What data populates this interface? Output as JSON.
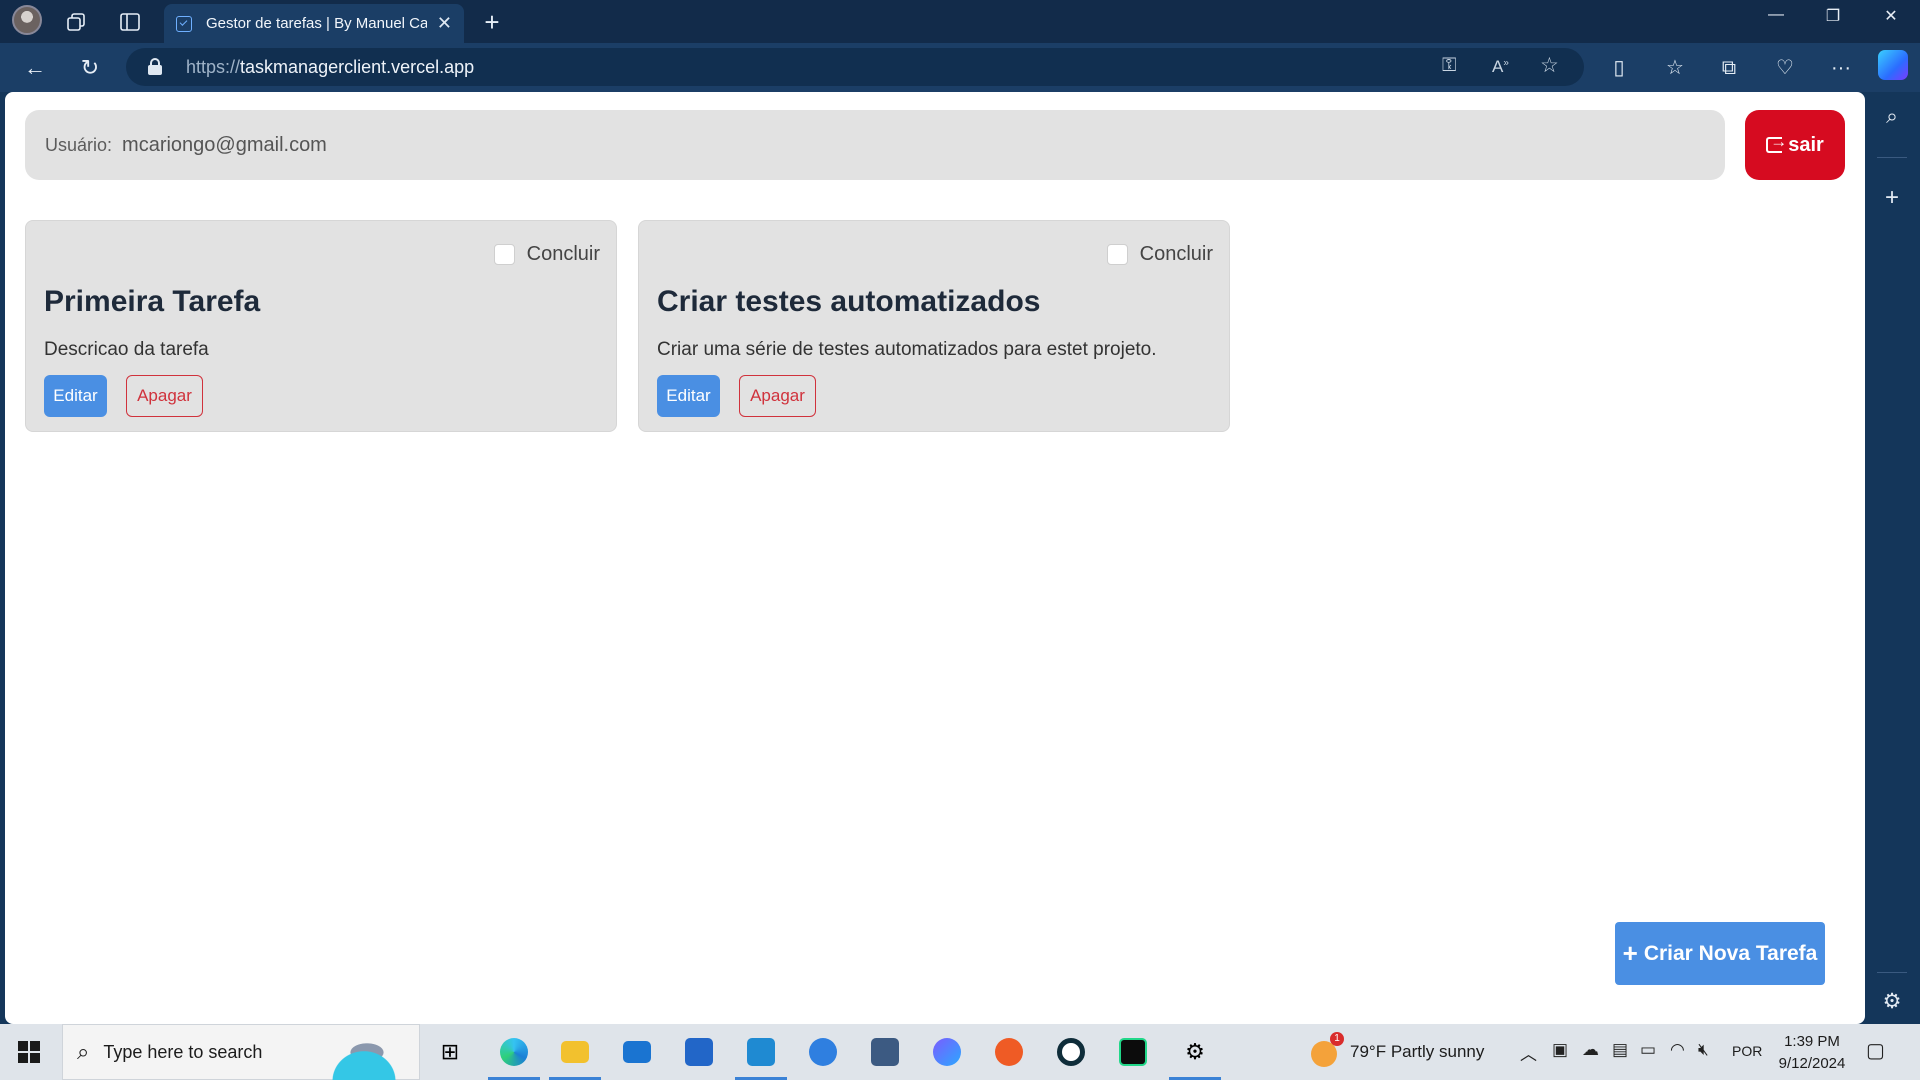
{
  "browser": {
    "tab_title": "Gestor de tarefas | By Manuel Car",
    "tab_close": "✕",
    "new_tab": "+",
    "url_scheme": "https://",
    "url_host": "taskmanagerclient.vercel.app",
    "window_controls": {
      "minimize": "—",
      "restore": "❐",
      "close": "✕"
    }
  },
  "app": {
    "user_label": "Usuário:",
    "user_email": "mcariongo@gmail.com",
    "logout_label": "sair",
    "complete_label": "Concluir",
    "edit_label": "Editar",
    "delete_label": "Apagar",
    "tasks": [
      {
        "title": "Primeira Tarefa",
        "description": "Descricao da tarefa"
      },
      {
        "title": "Criar testes automatizados",
        "description": "Criar uma série de testes automatizados para estet projeto."
      }
    ],
    "create_button": {
      "plus": "+",
      "label": "Criar Nova Tarefa"
    }
  },
  "taskbar": {
    "search_placeholder": "Type here to search",
    "weather": "79°F  Partly sunny",
    "weather_badge": "1",
    "language": "POR",
    "time": "1:39 PM",
    "date": "9/12/2024"
  },
  "colors": {
    "danger": "#d60b20",
    "primary": "#4a8fe3",
    "card_bg": "#e2e2e2"
  }
}
